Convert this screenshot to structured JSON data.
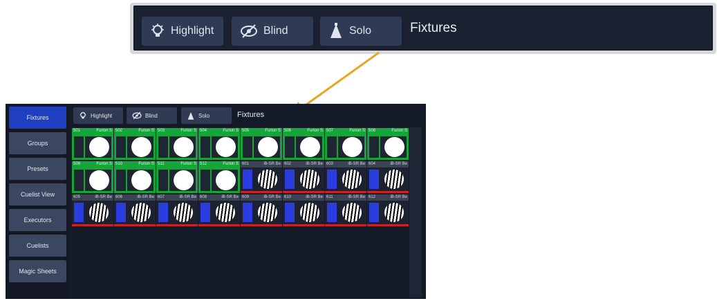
{
  "callout_toolbar": {
    "highlight_label": "Highlight",
    "blind_label": "Blind",
    "solo_label": "Solo",
    "title": "Fixtures"
  },
  "sidebar": {
    "items": [
      {
        "label": "Fixtures",
        "active": true
      },
      {
        "label": "Groups",
        "active": false
      },
      {
        "label": "Presets",
        "active": false
      },
      {
        "label": "Cuelist View",
        "active": false
      },
      {
        "label": "Executors",
        "active": false
      },
      {
        "label": "Cuelists",
        "active": false
      },
      {
        "label": "Magic Sheets",
        "active": false
      }
    ]
  },
  "toolbar": {
    "highlight_label": "Highlight",
    "blind_label": "Blind",
    "solo_label": "Solo",
    "title": "Fixtures"
  },
  "fixtures": [
    {
      "number": "501",
      "type": "Furion S",
      "state": "on"
    },
    {
      "number": "502",
      "type": "Furion S",
      "state": "on"
    },
    {
      "number": "503",
      "type": "Furion S",
      "state": "on"
    },
    {
      "number": "504",
      "type": "Furion S",
      "state": "on"
    },
    {
      "number": "505",
      "type": "Furion S",
      "state": "on"
    },
    {
      "number": "506",
      "type": "Furion S",
      "state": "on"
    },
    {
      "number": "507",
      "type": "Furion S",
      "state": "on"
    },
    {
      "number": "508",
      "type": "Furion S",
      "state": "on"
    },
    {
      "number": "509",
      "type": "Furion S",
      "state": "on"
    },
    {
      "number": "510",
      "type": "Furion S",
      "state": "on"
    },
    {
      "number": "511",
      "type": "Furion S",
      "state": "on"
    },
    {
      "number": "512",
      "type": "Furion S",
      "state": "on"
    },
    {
      "number": "601",
      "type": "iB-SR Be",
      "state": "off"
    },
    {
      "number": "602",
      "type": "iB-SR Be",
      "state": "off"
    },
    {
      "number": "603",
      "type": "iB-SR Be",
      "state": "off"
    },
    {
      "number": "604",
      "type": "iB-SR Be",
      "state": "off"
    },
    {
      "number": "605",
      "type": "iB-SR Be",
      "state": "off"
    },
    {
      "number": "606",
      "type": "iB-SR Be",
      "state": "off"
    },
    {
      "number": "607",
      "type": "iB-SR Be",
      "state": "off"
    },
    {
      "number": "608",
      "type": "iB-SR Be",
      "state": "off"
    },
    {
      "number": "609",
      "type": "iB-SR Be",
      "state": "off"
    },
    {
      "number": "610",
      "type": "iB-SR Be",
      "state": "off"
    },
    {
      "number": "611",
      "type": "iB-SR Be",
      "state": "off"
    },
    {
      "number": "612",
      "type": "iB-SR Be",
      "state": "off"
    }
  ],
  "colors": {
    "accent_active": "#1f3fc0",
    "fixture_on": "#16a53a",
    "fixture_off_bar": "#c8232b",
    "arrow": "#e8a422"
  }
}
